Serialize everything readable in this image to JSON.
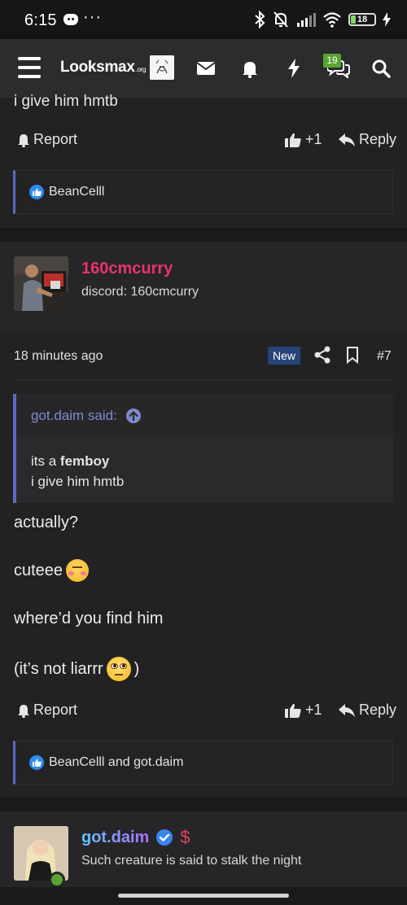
{
  "status_bar": {
    "time": "6:15",
    "dots": "···",
    "battery": "18"
  },
  "nav": {
    "logo_main": "Looksmax",
    "logo_suffix": ".org",
    "conversations_badge": "19"
  },
  "post1": {
    "cut_text": "i give him hmtb",
    "report_label": "Report",
    "like_label": "+1",
    "reply_label": "Reply",
    "reactions_text": "BeanCelll"
  },
  "post2": {
    "username": "160cmcurry",
    "username_color": "#e8336d",
    "user_title": "discord: 160cmcurry",
    "time_ago": "18 minutes ago",
    "new_badge": "New",
    "post_number": "#7",
    "quote": {
      "attribution": "got.daim said:",
      "line1_prefix": "its a ",
      "line1_bold": "femboy",
      "line2": "i give him hmtb"
    },
    "messages": {
      "m1": "actually?",
      "m2": "cuteee",
      "m3": "where’d you find him",
      "m4_prefix": "(it’s not liarrr",
      "m4_suffix": ")"
    },
    "report_label": "Report",
    "like_label": "+1",
    "reply_label": "Reply",
    "reactions_text": "BeanCelll and got.daim"
  },
  "next_user": {
    "username": "got.daim",
    "dollar_icon": "$",
    "user_title": "Such creature is said to stalk the night"
  }
}
